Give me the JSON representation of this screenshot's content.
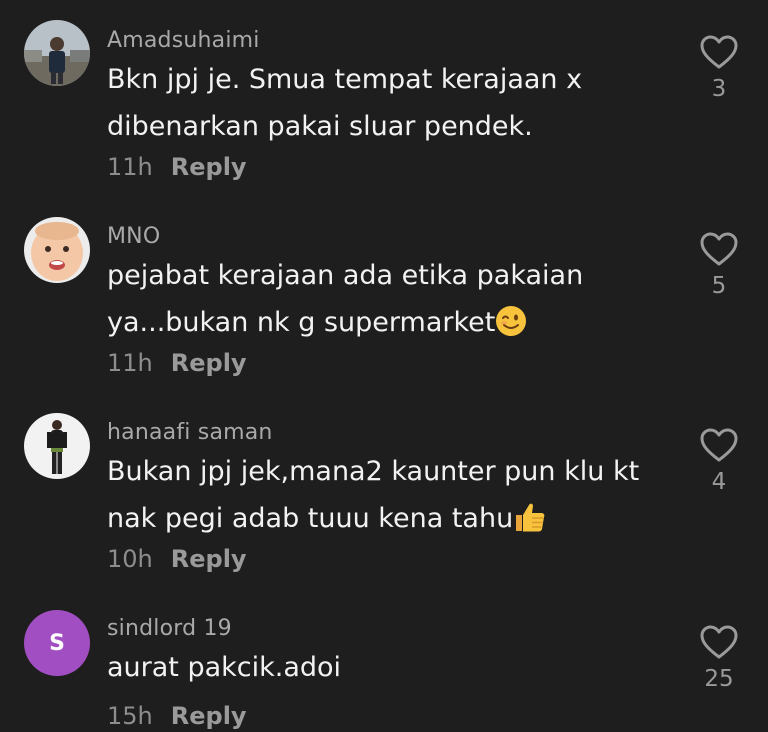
{
  "comments": [
    {
      "username": "Amadsuhaimi",
      "lines": [
        "Bkn jpj je. Smua tempat kerajaan x",
        "dibenarkan pakai sluar pendek."
      ],
      "time": "11h",
      "reply_label": "Reply",
      "likes": "3",
      "avatar": "photo-man-outdoor"
    },
    {
      "username": "MNO",
      "lines": [
        "pejabat kerajaan ada etika pakaian",
        "ya...bukan nk g supermarket"
      ],
      "trailing_emoji": "winking-face",
      "time": "11h",
      "reply_label": "Reply",
      "likes": "5",
      "avatar": "photo-baby"
    },
    {
      "username": "hanaafi saman",
      "lines": [
        "Bukan jpj jek,mana2 kaunter pun klu kt",
        "nak pegi adab tuuu kena tahu"
      ],
      "trailing_emoji": "thumbs-up",
      "time": "10h",
      "reply_label": "Reply",
      "likes": "4",
      "avatar": "photo-man-standing"
    },
    {
      "username": "sindlord 19",
      "lines": [
        "aurat pakcik.adoi"
      ],
      "time": "15h",
      "reply_label": "Reply",
      "likes": "25",
      "avatar": "letter",
      "avatar_letter": "S",
      "avatar_color": "#a24ec3"
    }
  ],
  "icons": {
    "like": "heart-outline-icon"
  }
}
